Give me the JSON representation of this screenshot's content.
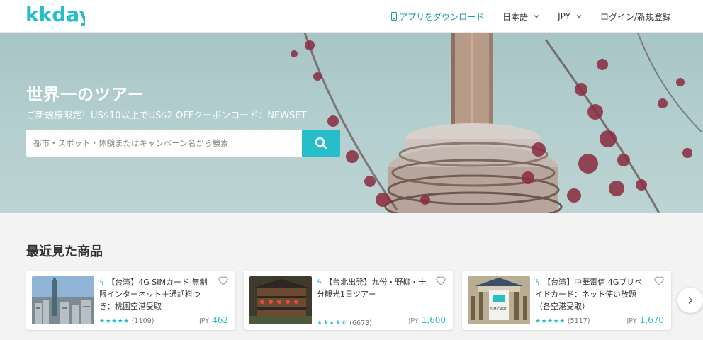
{
  "brand": {
    "logo_text": "kkday",
    "accent": "#26bec9"
  },
  "nav": {
    "app_download": "アプリをダウンロード",
    "language": "日本語",
    "currency": "JPY",
    "login": "ログイン/新規登録"
  },
  "hero": {
    "title": "世界一のツアー",
    "subtitle": "ご新規様限定！US$10以上でUS$2 OFFクーポンコード：NEWSET",
    "search_placeholder": "都市・スポット・体験またはキャンペーン名から検索"
  },
  "recent": {
    "title": "最近見た商品",
    "items": [
      {
        "title": "【台湾】4G SIMカード 無制限インターネット＋通話料つき：桃園空港受取",
        "reviews": "(1109)",
        "currency": "JPY",
        "price": "462",
        "rating": 5
      },
      {
        "title": "【台北出発】九份・野柳・十分観光1日ツアー",
        "reviews": "(6673)",
        "currency": "JPY",
        "price": "1,600",
        "rating": 4.5
      },
      {
        "title": "【台湾】中華電信 4Gプリペイドカード：ネット使い放題（各空港受取）",
        "reviews": "(5117)",
        "currency": "JPY",
        "price": "1,670",
        "rating": 5
      }
    ],
    "thumb_label": "SIM CARD"
  },
  "icons": {
    "phone": "phone-icon",
    "chevron": "chevron-down-icon",
    "search": "search-icon",
    "bolt": "lightning-icon",
    "heart": "heart-icon",
    "next": "chevron-right-icon"
  }
}
